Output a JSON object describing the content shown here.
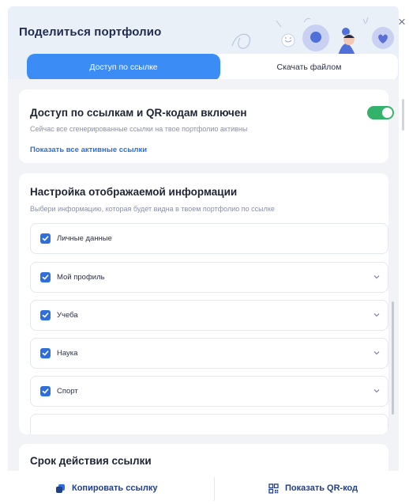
{
  "dialog": {
    "title": "Поделиться портфолио"
  },
  "tabs": [
    {
      "label": "Доступ по ссылке",
      "active": true
    },
    {
      "label": "Скачать файлом",
      "active": false
    }
  ],
  "access": {
    "title": "Доступ по ссылкам и QR-кодам включен",
    "description": "Сейчас все сгенерированные ссылки на твое портфолио активны",
    "link_label": "Показать все активные ссылки",
    "enabled": true
  },
  "display_settings": {
    "title": "Настройка отображаемой информации",
    "description": "Выбери информацию, которая будет видна в твоем портфолио по ссылке",
    "sections": [
      {
        "label": "Личные данные",
        "checked": true,
        "expandable": false
      },
      {
        "label": "Мой профиль",
        "checked": true,
        "expandable": true
      },
      {
        "label": "Учеба",
        "checked": true,
        "expandable": true
      },
      {
        "label": "Наука",
        "checked": true,
        "expandable": true
      },
      {
        "label": "Спорт",
        "checked": true,
        "expandable": true
      }
    ]
  },
  "expiry": {
    "title": "Срок действия ссылки"
  },
  "footer": {
    "copy_label": "Копировать ссылку",
    "qr_label": "Показать QR-код"
  },
  "colors": {
    "accent": "#3b8df5",
    "toggle_on": "#34b26a",
    "checkbox": "#2e6fdd",
    "link": "#2b6fd6",
    "header_bg": "#eaf0f8",
    "body_bg": "#f1f3f6"
  }
}
